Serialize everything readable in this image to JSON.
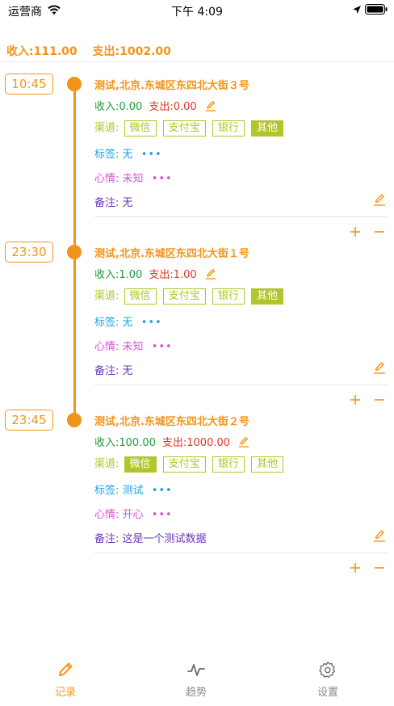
{
  "status_bar": {
    "carrier": "运营商",
    "time": "下午 4:09"
  },
  "summary": {
    "income": "收入:111.00",
    "expense": "支出:1002.00"
  },
  "colors": {
    "accent": "#f2941a",
    "income": "#1a9e3c",
    "expense": "#e8342a",
    "channel": "#b2c52c",
    "tags": "#1aa3e8",
    "mood": "#d94fd4",
    "note": "#6a35b8"
  },
  "entries": [
    {
      "time": "10:45",
      "location": "测试,北京.东城区东四北大街３号",
      "income": "收入:0.00",
      "expense": "支出:0.00",
      "channel_label": "渠道:",
      "channels": [
        "微信",
        "支付宝",
        "银行",
        "其他"
      ],
      "selected_channel": "其他",
      "tags_label": "标签:",
      "tags": "无",
      "mood_label": "心情:",
      "mood": "未知",
      "note_label": "备注:",
      "note": "无",
      "more": "•••"
    },
    {
      "time": "23:30",
      "location": "测试,北京.东城区东四北大街１号",
      "income": "收入:1.00",
      "expense": "支出:1.00",
      "channel_label": "渠道:",
      "channels": [
        "微信",
        "支付宝",
        "银行",
        "其他"
      ],
      "selected_channel": "其他",
      "tags_label": "标签:",
      "tags": "无",
      "mood_label": "心情:",
      "mood": "未知",
      "note_label": "备注:",
      "note": "无",
      "more": "•••"
    },
    {
      "time": "23:45",
      "location": "测试,北京.东城区东四北大街２号",
      "income": "收入:100.00",
      "expense": "支出:1000.00",
      "channel_label": "渠道:",
      "channels": [
        "微信",
        "支付宝",
        "银行",
        "其他"
      ],
      "selected_channel": "微信",
      "tags_label": "标签:",
      "tags": "测试",
      "mood_label": "心情:",
      "mood": "开心",
      "note_label": "备注:",
      "note": "这是一个测试数据",
      "more": "•••"
    }
  ],
  "tabs": [
    {
      "label": "记录",
      "icon": "pencil-icon",
      "active": true
    },
    {
      "label": "趋势",
      "icon": "trend-icon",
      "active": false
    },
    {
      "label": "设置",
      "icon": "gear-icon",
      "active": false
    }
  ]
}
